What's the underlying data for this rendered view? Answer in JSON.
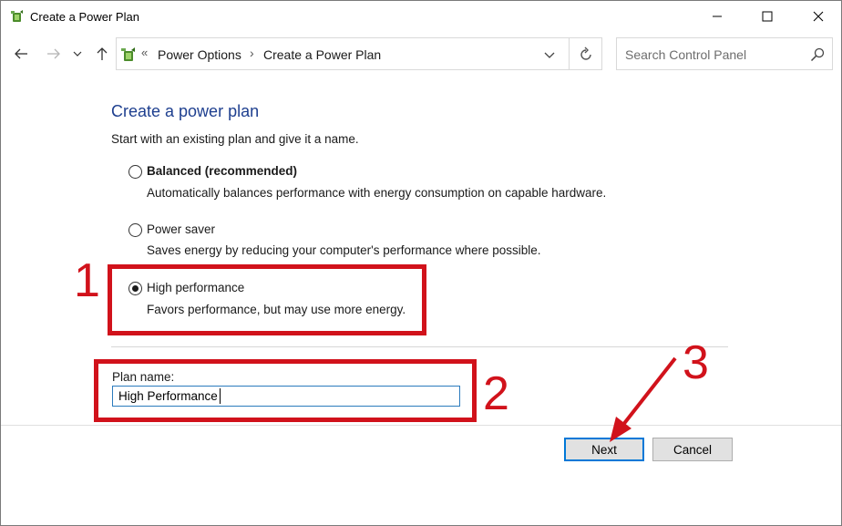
{
  "window": {
    "title": "Create a Power Plan",
    "controls": {
      "minimize": "minimize",
      "maximize": "maximize",
      "close": "close"
    }
  },
  "nav": {
    "breadcrumb": [
      "Power Options",
      "Create a Power Plan"
    ],
    "breadcrumb_overflow": "«",
    "breadcrumb_separator": "›",
    "search_placeholder": "Search Control Panel"
  },
  "content": {
    "title": "Create a power plan",
    "intro": "Start with an existing plan and give it a name.",
    "options": [
      {
        "label": "Balanced (recommended)",
        "description": "Automatically balances performance with energy consumption on capable hardware.",
        "selected": false,
        "bold": true
      },
      {
        "label": "Power saver",
        "description": "Saves energy by reducing your computer's performance where possible.",
        "selected": false,
        "bold": false
      },
      {
        "label": "High performance",
        "description": "Favors performance, but may use more energy.",
        "selected": true,
        "bold": false
      }
    ],
    "plan_name_label": "Plan name:",
    "plan_name_value": "High Performance"
  },
  "buttons": {
    "next": "Next",
    "cancel": "Cancel"
  },
  "annotations": {
    "step1": "1",
    "step2": "2",
    "step3": "3",
    "color": "#d1121b"
  },
  "colors": {
    "title_blue": "#1e3f8f",
    "focus_blue": "#0078d7"
  },
  "icons": [
    "power-options-icon",
    "back-arrow-icon",
    "forward-arrow-icon",
    "recent-chevron-icon",
    "up-arrow-icon",
    "dropdown-chevron-icon",
    "refresh-icon",
    "search-icon"
  ]
}
